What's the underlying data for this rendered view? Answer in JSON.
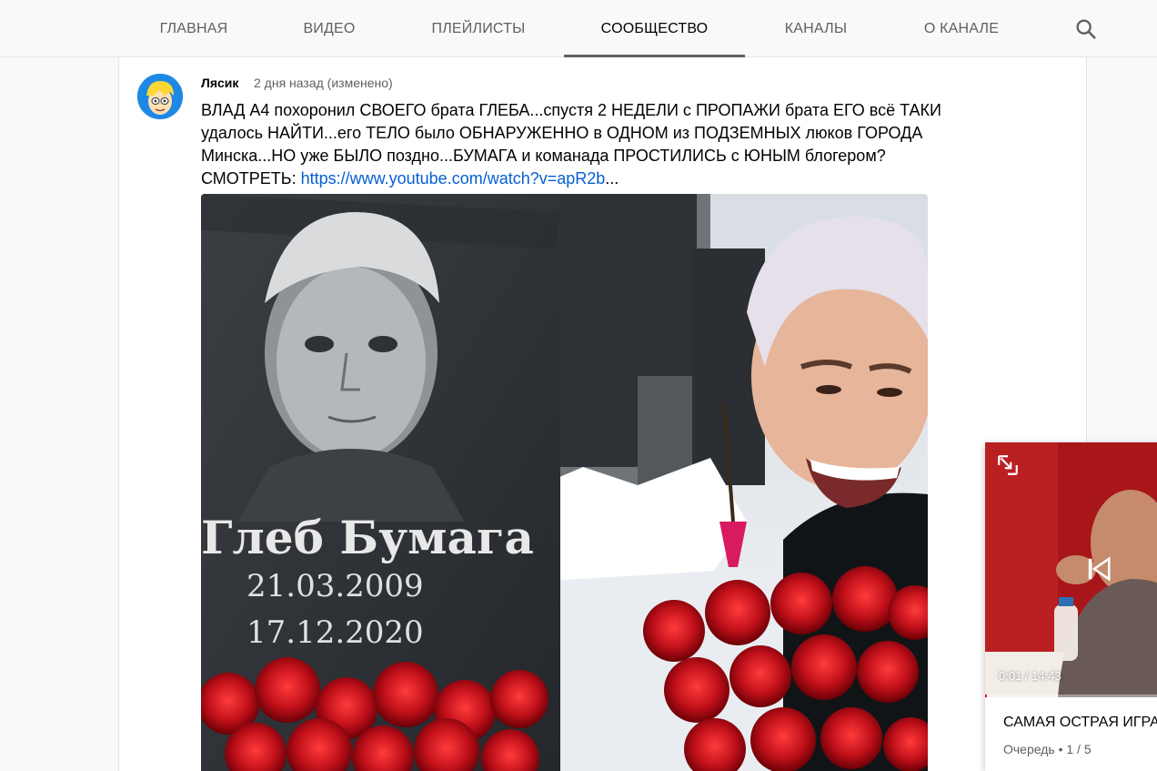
{
  "tabs": [
    {
      "label": "ГЛАВНАЯ"
    },
    {
      "label": "ВИДЕО"
    },
    {
      "label": "ПЛЕЙЛИСТЫ"
    },
    {
      "label": "СООБЩЕСТВО"
    },
    {
      "label": "КАНАЛЫ"
    },
    {
      "label": "О КАНАЛЕ"
    }
  ],
  "active_tab": "СООБЩЕСТВО",
  "search_icon": "search-icon",
  "post": {
    "author": "Лясик",
    "time": "2 дня назад (изменено)",
    "text_line1": "ВЛАД А4 похоронил СВОЕГО брата ГЛЕБА...спустя 2 НЕДЕЛИ с ПРОПАЖИ брата ЕГО всё ТАКИ",
    "text_line2": "удалось НАЙТИ...его ТЕЛО было ОБНАРУЖЕННО в ОДНОМ из ПОДЗЕМНЫХ люков ГОРОДА",
    "text_line3": "Минска...НО уже БЫЛО поздно...БУМАГА  и команада ПРОСТИЛИСЬ с  ЮНЫМ блогером?",
    "text_prefix": "СМОТРЕТЬ: ",
    "link_text": "https://www.youtube.com/watch?v=apR2b",
    "link_suffix": "...",
    "image": {
      "name_text": "Глеб Бумага",
      "date_born": "21.03.2009",
      "date_died": "17.12.2020"
    }
  },
  "miniplayer": {
    "time": "0:01 / 14:43",
    "progress": 0.001,
    "title": "САМАЯ ОСТРАЯ ИГРА",
    "queue": "Очередь • 1 / 5"
  },
  "colors": {
    "link": "#065fd4",
    "accent_red": "#ff0000"
  }
}
